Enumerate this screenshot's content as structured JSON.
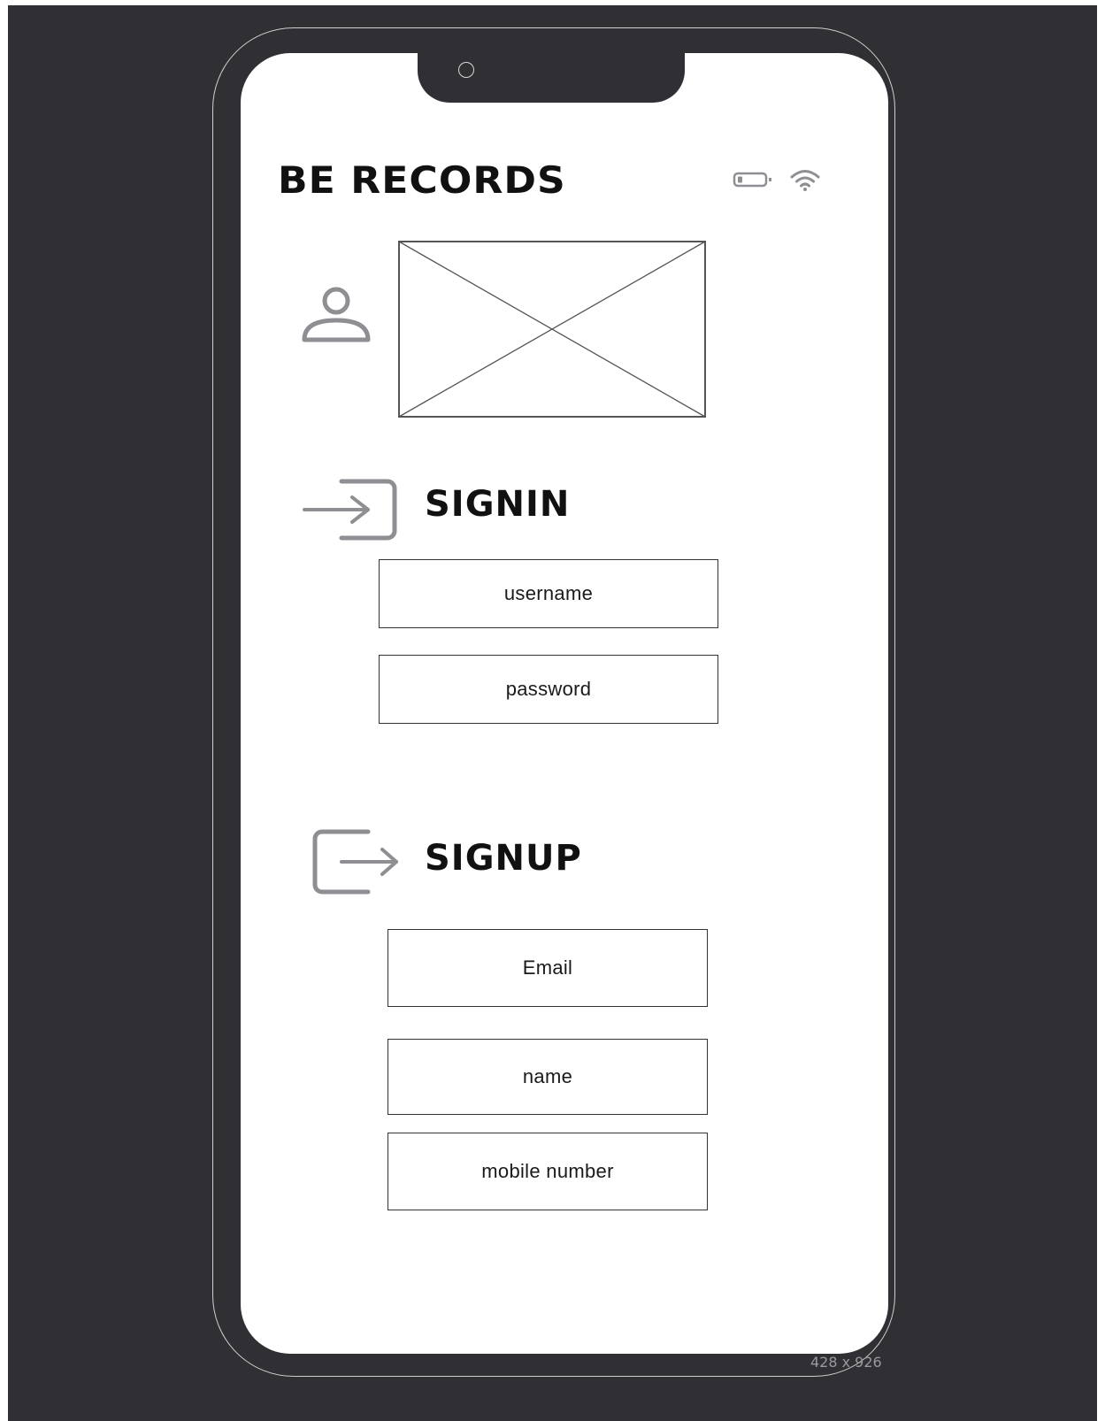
{
  "app": {
    "brand": "BE RECORDS"
  },
  "status_bar": {
    "icons": [
      "battery-icon",
      "wifi-icon"
    ]
  },
  "hero": {
    "icons": [
      "user-avatar-icon",
      "image-placeholder-icon"
    ]
  },
  "signin": {
    "title": "SIGNIN",
    "icon": "login-icon",
    "fields": [
      {
        "label": "username"
      },
      {
        "label": "password"
      }
    ]
  },
  "signup": {
    "title": "SIGNUP",
    "icon": "logout-signup-icon",
    "fields": [
      {
        "label": "Email"
      },
      {
        "label": "name"
      },
      {
        "label": "mobile number"
      }
    ]
  },
  "frame": {
    "size_label": "428 x 926"
  },
  "colors": {
    "background": "#303034",
    "screen": "#ffffff",
    "icon_gray": "#8e8e93",
    "text": "#111111"
  }
}
